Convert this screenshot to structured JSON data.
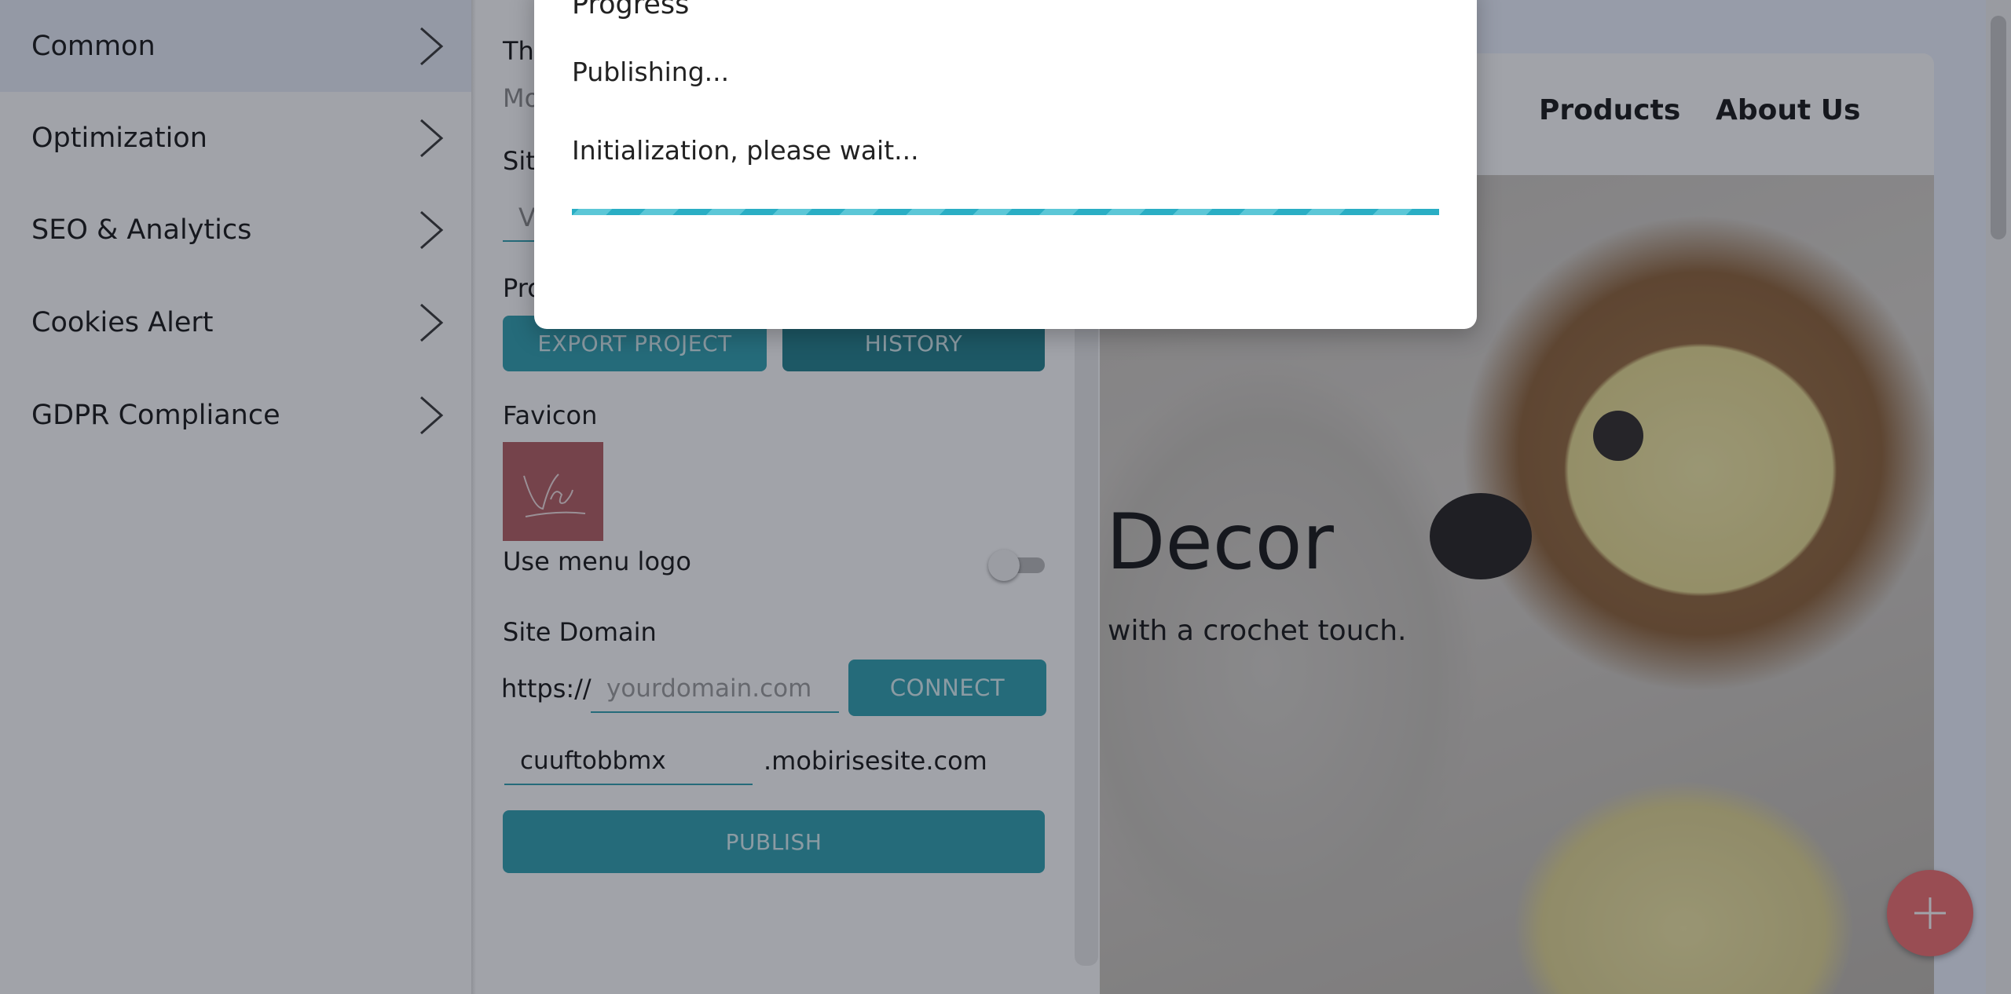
{
  "sidebar": {
    "items": [
      {
        "label": "Common",
        "active": true
      },
      {
        "label": "Optimization",
        "active": false
      },
      {
        "label": "SEO & Analytics",
        "active": false
      },
      {
        "label": "Cookies Alert",
        "active": false
      },
      {
        "label": "GDPR Compliance",
        "active": false
      }
    ]
  },
  "panel": {
    "partial_labels": {
      "theme": "The",
      "theme_value": "Mo",
      "site": "Site",
      "site_value": "V",
      "project": "Pro"
    },
    "export_label": "EXPORT PROJECT",
    "history_label": "HISTORY",
    "favicon_label": "Favicon",
    "use_menu_logo_label": "Use menu logo",
    "use_menu_logo_on": false,
    "site_domain_label": "Site Domain",
    "https_prefix": "https://",
    "domain_placeholder": "yourdomain.com",
    "connect_label": "CONNECT",
    "subdomain_value": "cuuftobbmx",
    "subdomain_suffix": ".mobirisesite.com",
    "publish_label": "PUBLISH"
  },
  "preview": {
    "nav": [
      "Products",
      "About Us"
    ],
    "hero_title": "Decor",
    "hero_subtitle": "with a crochet touch."
  },
  "dialog": {
    "title": "Progress",
    "status": "Publishing...",
    "message": "Initialization, please wait..."
  },
  "colors": {
    "accent": "#2a9fae",
    "fab": "#f26b6b",
    "favicon": "#b35a5e"
  },
  "icons": {
    "chevron": "chevron-right-icon",
    "fab": "plus-icon"
  }
}
